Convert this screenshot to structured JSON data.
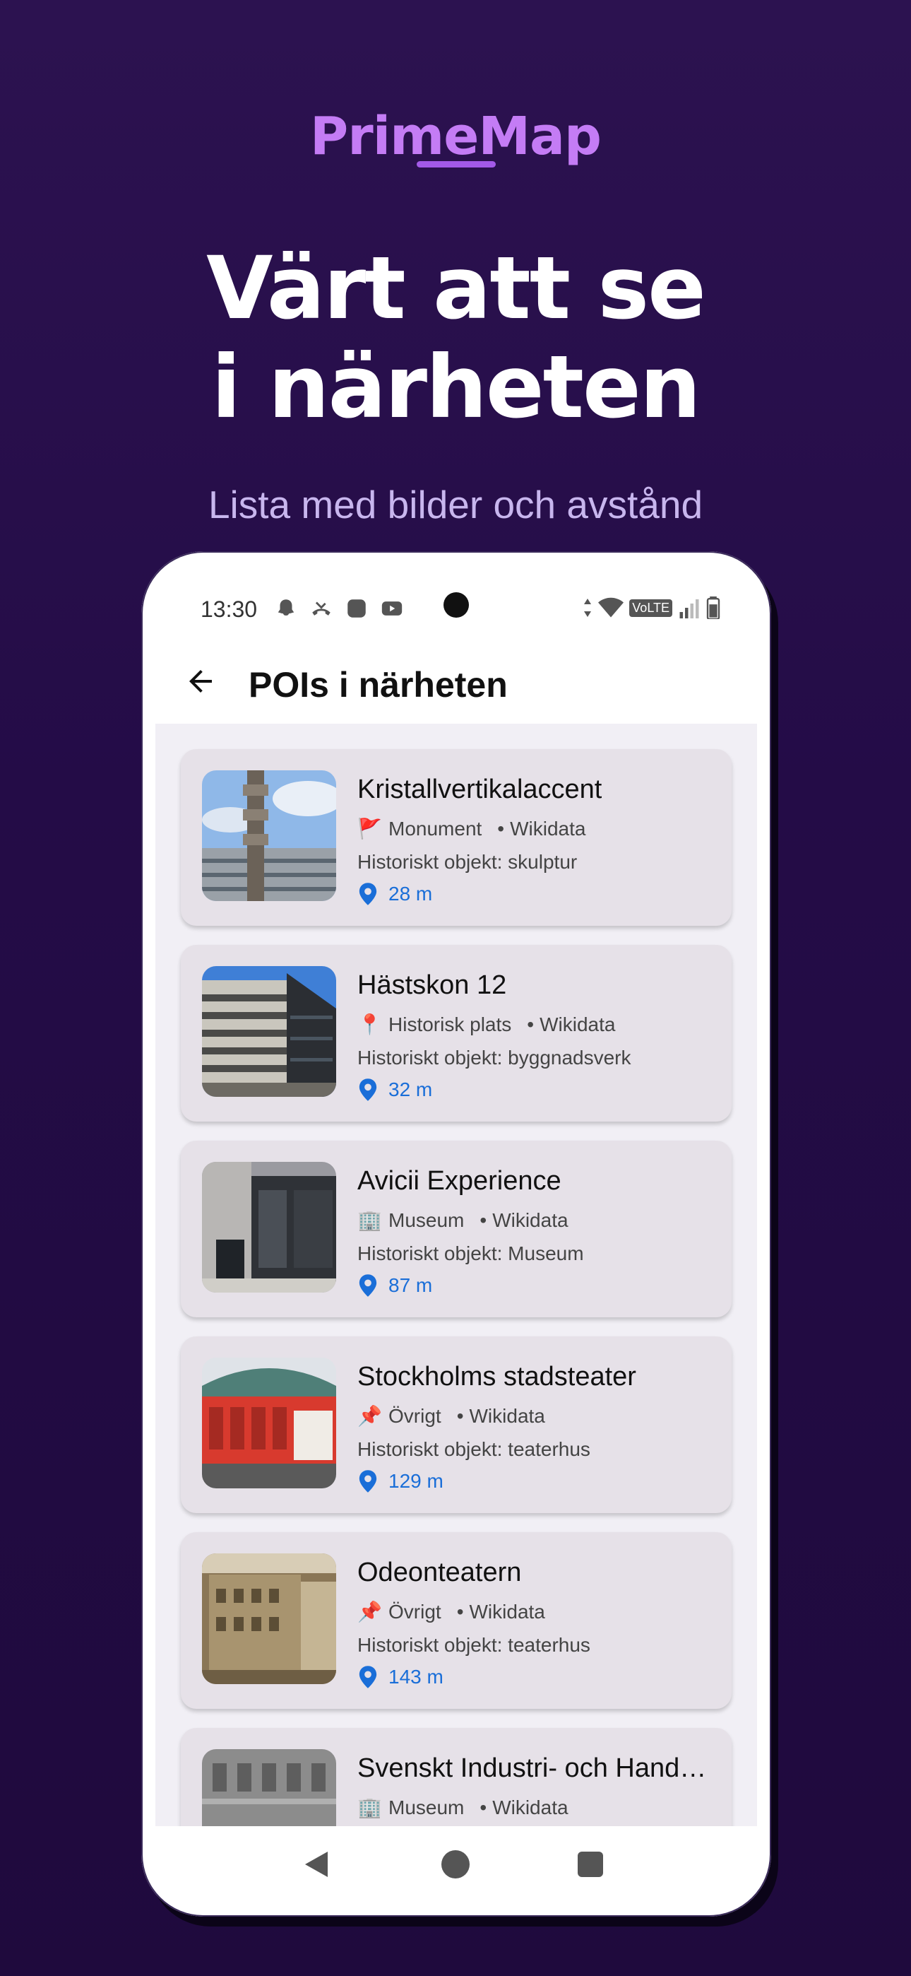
{
  "brand": {
    "name": "PrimeMap"
  },
  "hero": {
    "headline_line1": "Värt att se",
    "headline_line2": "i närheten",
    "subtitle": "Lista med bilder och avstånd"
  },
  "status_bar": {
    "time": "13:30",
    "network": "VoLTE"
  },
  "app_bar": {
    "title": "POIs i närheten",
    "back_icon": "arrow-back-icon"
  },
  "pois": [
    {
      "title": "Kristallvertikalaccent",
      "icon": "🚩",
      "category": "Monument",
      "source": "Wikidata",
      "description": "Historiskt objekt: skulptur",
      "distance": "28 m"
    },
    {
      "title": "Hästskon 12",
      "icon": "📍",
      "category": "Historisk plats",
      "source": "Wikidata",
      "description": "Historiskt objekt: byggnadsverk",
      "distance": "32 m"
    },
    {
      "title": "Avicii Experience",
      "icon": "🏢",
      "category": "Museum",
      "source": "Wikidata",
      "description": "Historiskt objekt: Museum",
      "distance": "87 m"
    },
    {
      "title": "Stockholms stadsteater",
      "icon": "📌",
      "category": "Övrigt",
      "source": "Wikidata",
      "description": "Historiskt objekt: teaterhus",
      "distance": "129 m"
    },
    {
      "title": "Odeonteatern",
      "icon": "📌",
      "category": "Övrigt",
      "source": "Wikidata",
      "description": "Historiskt objekt: teaterhus",
      "distance": "143 m"
    },
    {
      "title": "Svenskt Industri- och Hand…",
      "icon": "🏢",
      "category": "Museum",
      "source": "Wikidata",
      "description": "",
      "distance": ""
    }
  ],
  "colors": {
    "background": "#240c47",
    "brand": "#c47cf5",
    "distance": "#1a6ed8",
    "card": "#e6e1e8"
  }
}
